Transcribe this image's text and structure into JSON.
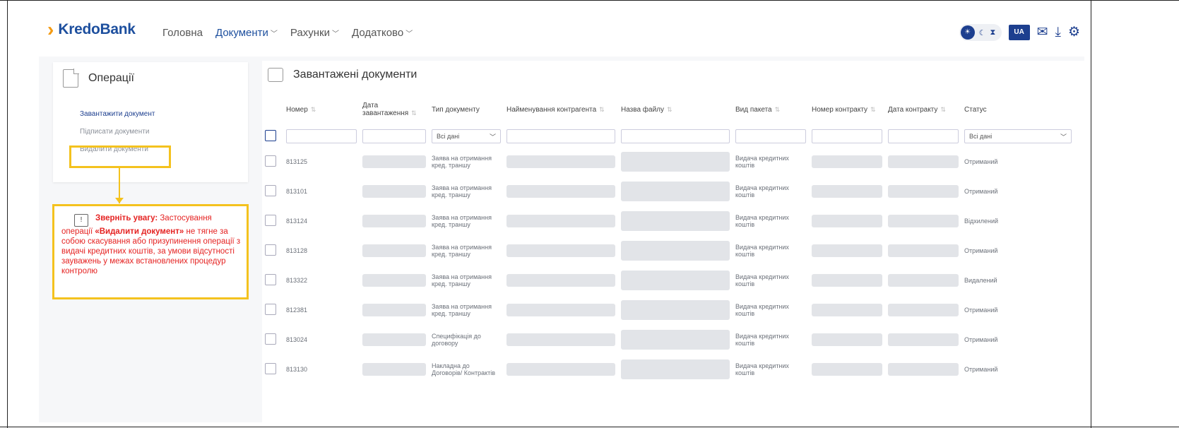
{
  "header": {
    "logo": "KredoBank",
    "nav": [
      {
        "label": "Головна",
        "active": false,
        "has_menu": false
      },
      {
        "label": "Документи",
        "active": true,
        "has_menu": true
      },
      {
        "label": "Рахунки",
        "active": false,
        "has_menu": true
      },
      {
        "label": "Додатково",
        "active": false,
        "has_menu": true
      }
    ],
    "lang": "UA",
    "icons": [
      "theme-toggle-icon",
      "mail-icon",
      "download-icon",
      "settings-icon"
    ]
  },
  "sidebar": {
    "title": "Операції",
    "items": [
      {
        "label": "Завантажити документ"
      },
      {
        "label": "Підписати документи"
      },
      {
        "label": "Видалити документи"
      }
    ]
  },
  "note": {
    "prefix": "Зверніть увагу:",
    "text1": " Застосування операції ",
    "operation": "«Видалити документ»",
    "text2": " не тягне за собою скасування або призупинення операції з видачі кредитних коштів, за умови відсутності зауважень у межах встановлених процедур контролю"
  },
  "main": {
    "title": "Завантажені документи",
    "columns": [
      "Номер",
      "Дата завантаження",
      "Тип документу",
      "Найменування контрагента",
      "Назва файлу",
      "Вид пакета",
      "Номер контракту",
      "Дата контракту",
      "Статус"
    ],
    "filter_all": "Всі дані",
    "rows": [
      {
        "number": "813125",
        "type": "Заява на отримання кред. траншу",
        "package": "Видача кредитних коштів",
        "status": "Отриманий"
      },
      {
        "number": "813101",
        "type": "Заява на отримання кред. траншу",
        "package": "Видача кредитних коштів",
        "status": "Отриманий"
      },
      {
        "number": "813124",
        "type": "Заява на отримання кред. траншу",
        "package": "Видача кредитних коштів",
        "status": "Відхилений"
      },
      {
        "number": "813128",
        "type": "Заява на отримання кред. траншу",
        "package": "Видача кредитних коштів",
        "status": "Отриманий"
      },
      {
        "number": "813322",
        "type": "Заява на отримання кред. траншу",
        "package": "Видача кредитних коштів",
        "status": "Видалений"
      },
      {
        "number": "812381",
        "type": "Заява на отримання кред. траншу",
        "package": "Видача кредитних коштів",
        "status": "Отриманий"
      },
      {
        "number": "813024",
        "type": "Специфікація до договору",
        "package": "Видача кредитних коштів",
        "status": "Отриманий"
      },
      {
        "number": "813130",
        "type": "Накладна до Договорів/ Контрактів",
        "package": "Видача кредитних коштів",
        "status": "Отриманий"
      }
    ]
  }
}
